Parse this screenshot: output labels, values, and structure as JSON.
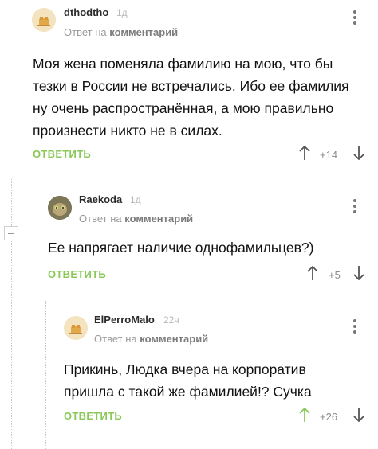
{
  "comments": [
    {
      "username": "dthodtho",
      "time": "1д",
      "reply_prefix": "Ответ на",
      "reply_link": "комментарий",
      "text": "Моя жена поменяла фамилию на мою, что бы тезки в России не встречались. Ибо ее фамилия ну очень распространённая, а мою правильно произнести никто не в силах.",
      "reply_label": "ОТВЕТИТЬ",
      "rating": "+14",
      "colors": {
        "accent": "#8ac858"
      }
    },
    {
      "username": "Raekoda",
      "time": "1д",
      "reply_prefix": "Ответ на",
      "reply_link": "комментарий",
      "text": "Ее напрягает наличие однофамильцев?)",
      "reply_label": "ОТВЕТИТЬ",
      "rating": "+5"
    },
    {
      "username": "ElPerroMalo",
      "time": "22ч",
      "reply_prefix": "Ответ на",
      "reply_link": "комментарий",
      "text": "Прикинь, Людка вчера на корпоратив пришла с такой же фамилией!? Сучка",
      "reply_label": "ОТВЕТИТЬ",
      "rating": "+26",
      "rating_state": "upvoted"
    }
  ],
  "icons": [
    "collapse-icon",
    "more-vertical-icon",
    "upvote-arrow-icon",
    "downvote-arrow-icon",
    "avatar"
  ]
}
